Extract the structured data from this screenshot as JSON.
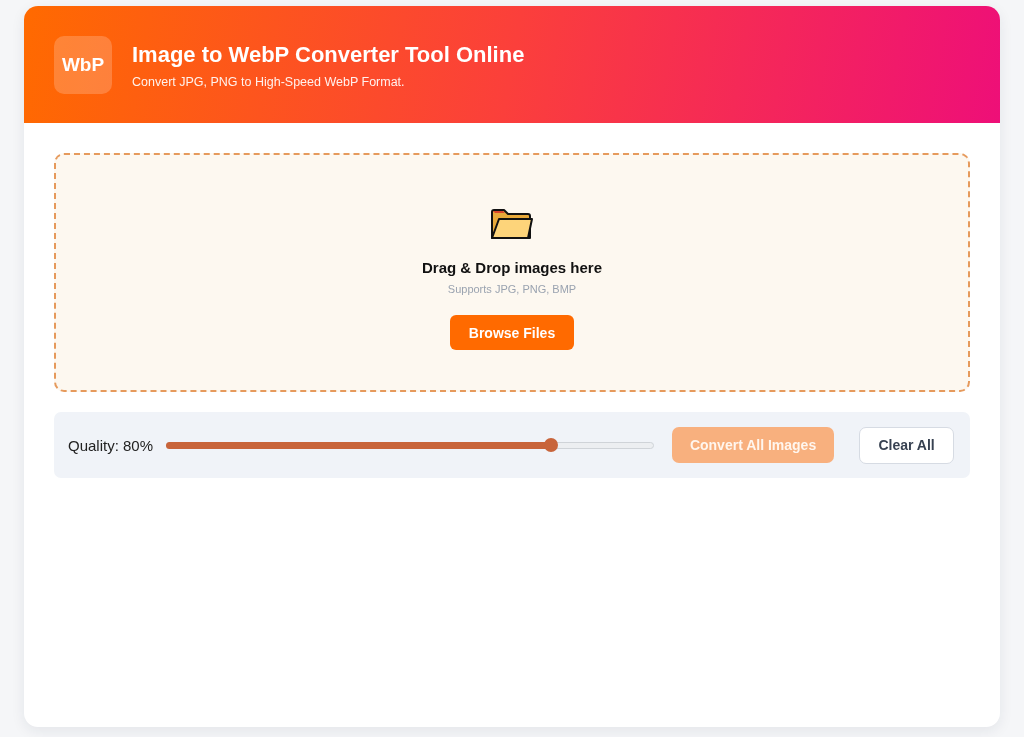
{
  "header": {
    "logo": "WbP",
    "title": "Image to WebP Converter Tool Online",
    "subtitle": "Convert JPG, PNG to High-Speed WebP Format."
  },
  "dropzone": {
    "heading": "Drag & Drop images here",
    "hint": "Supports JPG, PNG, BMP",
    "button": "Browse Files"
  },
  "controls": {
    "quality_label": "Quality: 80%",
    "quality": {
      "level": 0.79
    },
    "buttons": [
      {
        "label": "Convert All Images",
        "kind": "primary",
        "disabled": true
      },
      {
        "label": "Clear All",
        "kind": "secondary",
        "disabled": false
      }
    ]
  }
}
